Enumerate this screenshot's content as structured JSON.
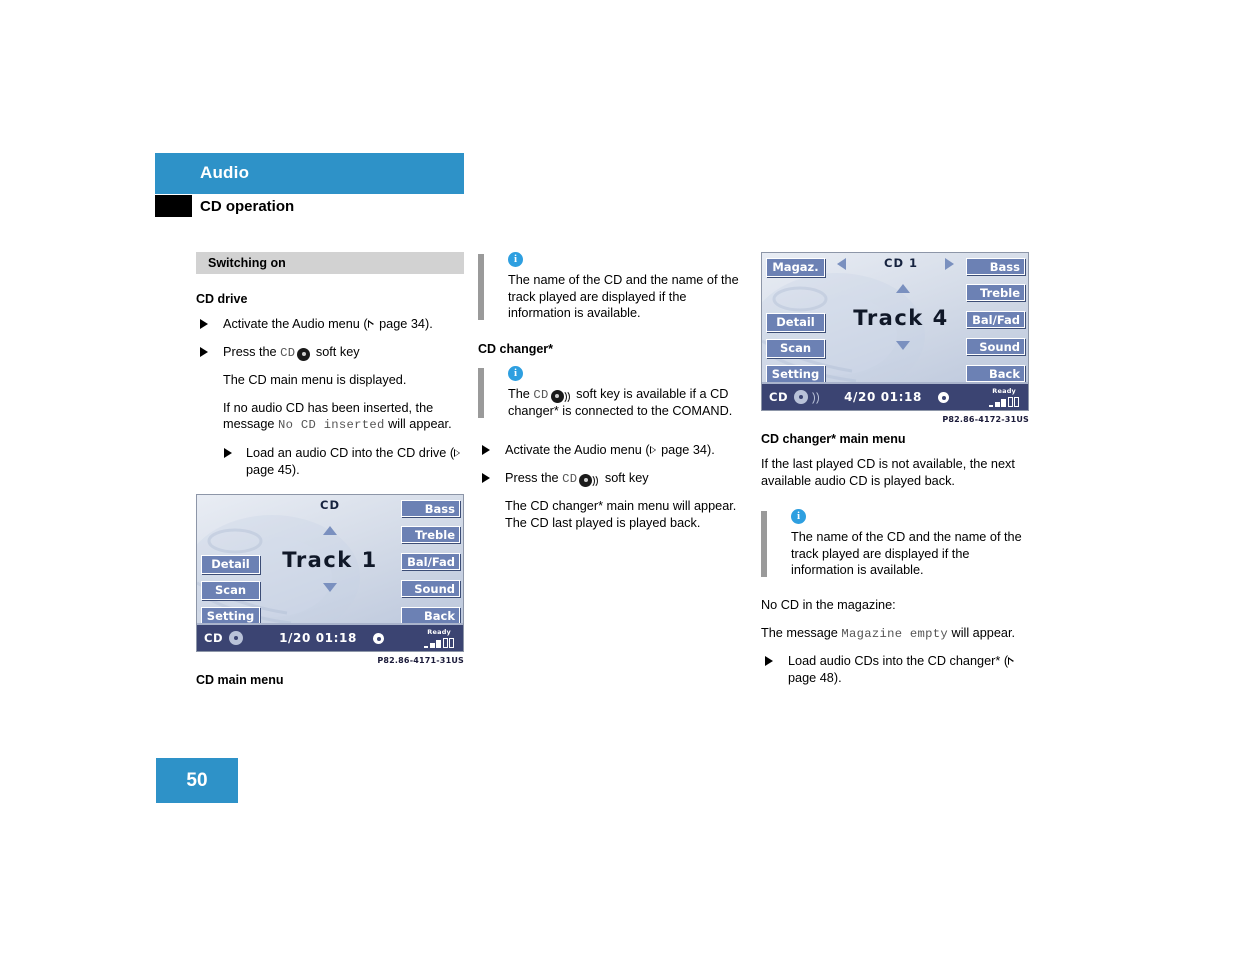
{
  "header": {
    "band_title": "Audio",
    "subtitle": "CD operation",
    "band_color": "#2e92c8"
  },
  "page_number": "50",
  "col1": {
    "section_bar": "Switching on",
    "subheading": "CD drive",
    "bullet_1_pre": "Activate the Audio menu (",
    "bullet_1_page": " page 34).",
    "bullet_2_pre": "Press the ",
    "bullet_2_key": "CD",
    "bullet_2_post": " soft key",
    "para_1": "The CD main menu is displayed.",
    "para_2_pre": "If no audio CD has been inserted, the message ",
    "para_2_mono": "No CD inserted",
    "para_2_post": " will appear.",
    "bullet_3_pre": "Load an audio CD into the CD drive (",
    "bullet_3_page": " page 45).",
    "display": {
      "title": "CD",
      "track": "Track 1",
      "softkeys_left": [
        "Detail",
        "Scan",
        "Setting"
      ],
      "softkeys_right": [
        "Bass",
        "Treble",
        "Bal/Fad",
        "Sound",
        "Back"
      ],
      "status_source": "CD",
      "status_time": "1/20  01:18",
      "status_signal_label": "Ready"
    },
    "fig_code": "P82.86-4171-31US",
    "fig_caption": "CD main menu"
  },
  "col2": {
    "note_1": "The name of the CD and the name of the track played are displayed if the information is available.",
    "subheading": "CD changer*",
    "note_2_pre": "The ",
    "note_2_key": "CD",
    "note_2_post": " soft key is available if a CD changer* is connected to the COMAND.",
    "bullet_1_pre": "Activate the Audio menu (",
    "bullet_1_page": " page 34).",
    "bullet_2_pre": "Press the ",
    "bullet_2_key": "CD",
    "bullet_2_post": " soft key",
    "para_1": "The CD changer* main menu will appear. The CD last played is played back."
  },
  "col3": {
    "display": {
      "magaz_key": "Magaz.",
      "title": "CD 1",
      "track": "Track 4",
      "softkeys_left": [
        "Detail",
        "Scan",
        "Setting"
      ],
      "softkeys_right": [
        "Bass",
        "Treble",
        "Bal/Fad",
        "Sound",
        "Back"
      ],
      "status_source": "CD",
      "status_time": "4/20  01:18",
      "status_signal_label": "Ready"
    },
    "fig_code": "P82.86-4172-31US",
    "fig_caption": "CD changer* main menu",
    "para_1": "If the last played CD is not available, the next available audio CD is played back.",
    "note_1": "The name of the CD and the name of the track played are displayed if the information is available.",
    "para_2": "No CD in the magazine:",
    "para_3_pre": "The message ",
    "para_3_mono": "Magazine empty",
    "para_3_post": " will appear.",
    "bullet_1_pre": "Load audio CDs into the CD changer* (",
    "bullet_1_page": " page 48)."
  }
}
